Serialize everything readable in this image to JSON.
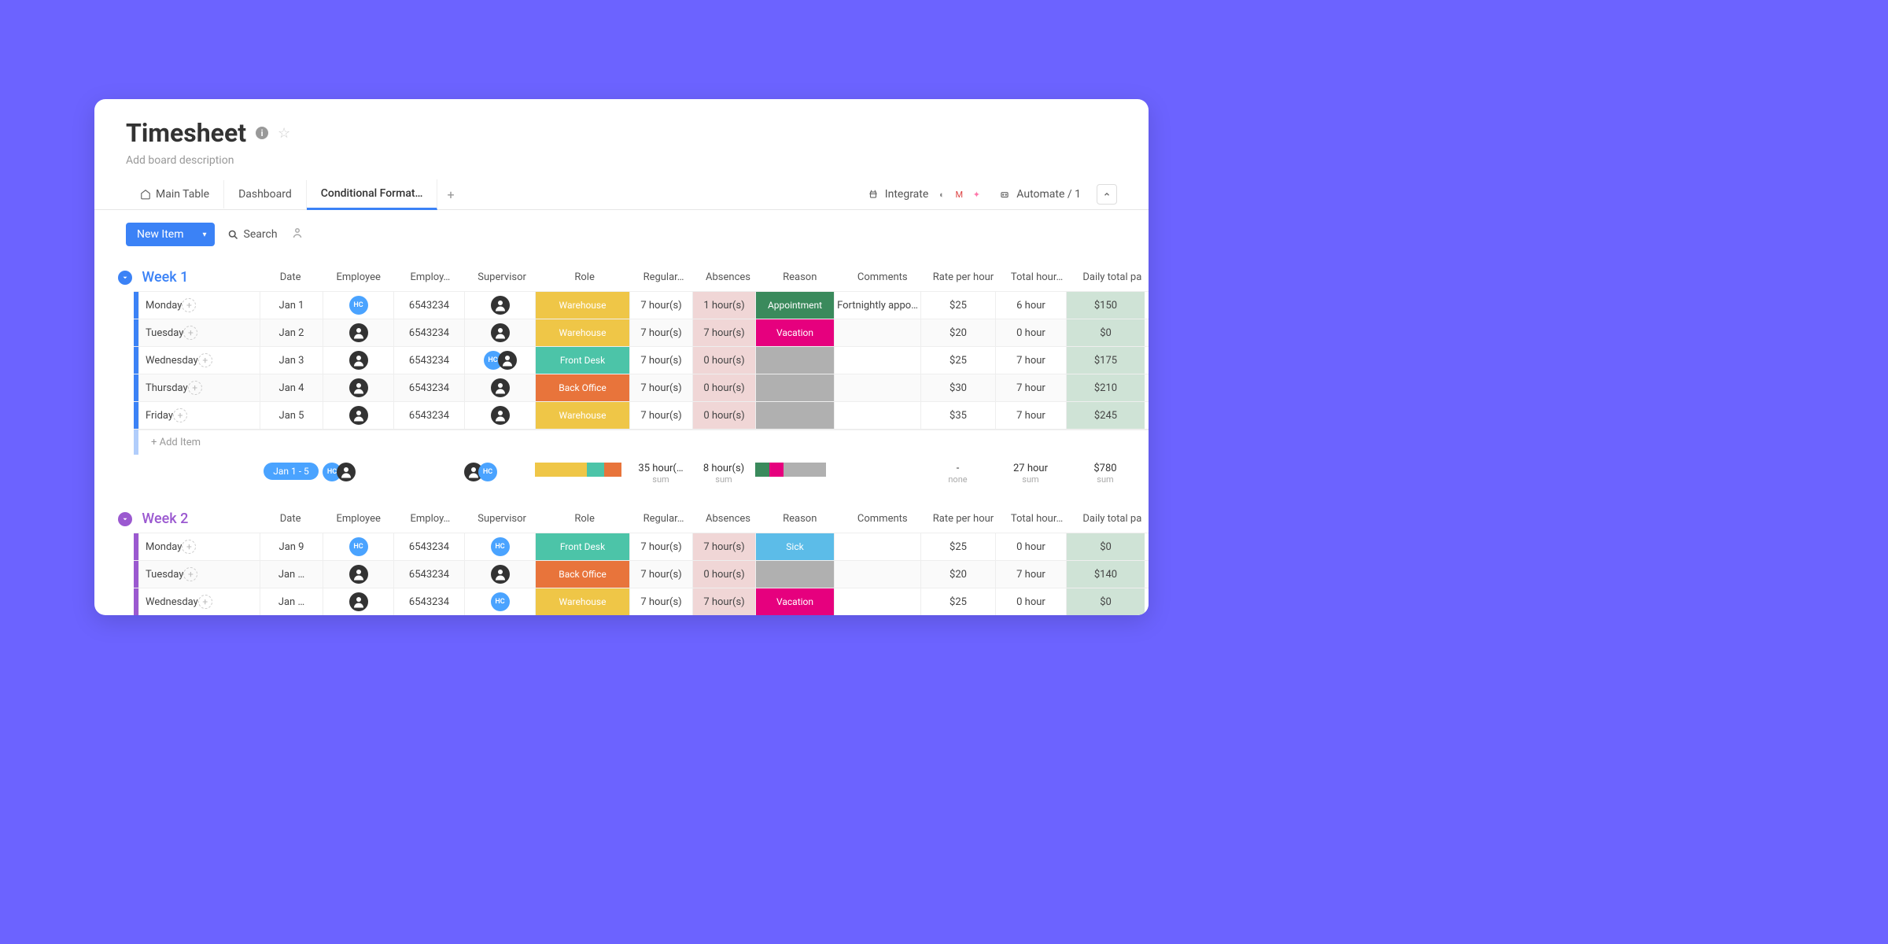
{
  "header": {
    "title": "Timesheet",
    "description": "Add board description"
  },
  "tabs": [
    {
      "label": "Main Table",
      "active": false,
      "has_icon": true
    },
    {
      "label": "Dashboard",
      "active": false,
      "has_icon": false
    },
    {
      "label": "Conditional Format…",
      "active": true,
      "has_icon": false
    }
  ],
  "top_actions": {
    "integrate": "Integrate",
    "automate": "Automate / 1"
  },
  "toolbar": {
    "new_item": "New Item",
    "search": "Search"
  },
  "columns": [
    "",
    "Date",
    "Employee",
    "Employ…",
    "Supervisor",
    "Role",
    "Regular…",
    "Absences",
    "Reason",
    "Comments",
    "Rate per hour",
    "Total hour…",
    "Daily total pa"
  ],
  "groups": [
    {
      "name": "Week 1",
      "color": "#3b82f6",
      "text_color": "#3b82f6",
      "rows": [
        {
          "item": "Monday",
          "date": "Jan 1",
          "emp": "hc",
          "empid": "6543234",
          "sup": "black",
          "role": "Warehouse",
          "role_color": "#efc647",
          "reg": "7 hour(s)",
          "abs": "1 hour(s)",
          "reason": "Appointment",
          "reason_color": "#3a8a5c",
          "comments": "Fortnightly appo…",
          "rate": "$25",
          "total": "6 hour",
          "daily": "$150"
        },
        {
          "item": "Tuesday",
          "date": "Jan 2",
          "emp": "black",
          "empid": "6543234",
          "sup": "black",
          "role": "Warehouse",
          "role_color": "#efc647",
          "reg": "7 hour(s)",
          "abs": "7 hour(s)",
          "reason": "Vacation",
          "reason_color": "#e6007e",
          "comments": "",
          "rate": "$20",
          "total": "0 hour",
          "daily": "$0"
        },
        {
          "item": "Wednesday",
          "date": "Jan 3",
          "emp": "black",
          "empid": "6543234",
          "sup": "hc+black",
          "role": "Front Desk",
          "role_color": "#4cc4a8",
          "reg": "7 hour(s)",
          "abs": "0 hour(s)",
          "reason": "",
          "reason_color": "#b0b0b0",
          "comments": "",
          "rate": "$25",
          "total": "7 hour",
          "daily": "$175"
        },
        {
          "item": "Thursday",
          "date": "Jan 4",
          "emp": "black",
          "empid": "6543234",
          "sup": "black",
          "role": "Back Office",
          "role_color": "#e8743b",
          "reg": "7 hour(s)",
          "abs": "0 hour(s)",
          "reason": "",
          "reason_color": "#b0b0b0",
          "comments": "",
          "rate": "$30",
          "total": "7 hour",
          "daily": "$210"
        },
        {
          "item": "Friday",
          "date": "Jan 5",
          "emp": "black",
          "empid": "6543234",
          "sup": "black",
          "role": "Warehouse",
          "role_color": "#efc647",
          "reg": "7 hour(s)",
          "abs": "0 hour(s)",
          "reason": "",
          "reason_color": "#b0b0b0",
          "comments": "",
          "rate": "$35",
          "total": "7 hour",
          "daily": "$245"
        }
      ],
      "add_item": "+ Add Item",
      "summary": {
        "date_range": "Jan 1 - 5",
        "reg": "35 hour(…",
        "reg_lbl": "sum",
        "abs": "8 hour(s)",
        "abs_lbl": "sum",
        "rate": "-",
        "rate_lbl": "none",
        "total": "27 hour",
        "total_lbl": "sum",
        "daily": "$780",
        "daily_lbl": "sum"
      }
    },
    {
      "name": "Week 2",
      "color": "#9b59d0",
      "text_color": "#9b59d0",
      "rows": [
        {
          "item": "Monday",
          "date": "Jan 9",
          "emp": "hc",
          "empid": "6543234",
          "sup": "hc",
          "role": "Front Desk",
          "role_color": "#4cc4a8",
          "reg": "7 hour(s)",
          "abs": "7 hour(s)",
          "reason": "Sick",
          "reason_color": "#5cbce8",
          "comments": "",
          "rate": "$25",
          "total": "0 hour",
          "daily": "$0"
        },
        {
          "item": "Tuesday",
          "date": "Jan …",
          "emp": "black",
          "empid": "6543234",
          "sup": "black",
          "role": "Back Office",
          "role_color": "#e8743b",
          "reg": "7 hour(s)",
          "abs": "0 hour(s)",
          "reason": "",
          "reason_color": "#b0b0b0",
          "comments": "",
          "rate": "$20",
          "total": "7 hour",
          "daily": "$140"
        },
        {
          "item": "Wednesday",
          "date": "Jan …",
          "emp": "black",
          "empid": "6543234",
          "sup": "hc",
          "role": "Warehouse",
          "role_color": "#efc647",
          "reg": "7 hour(s)",
          "abs": "7 hour(s)",
          "reason": "Vacation",
          "reason_color": "#e6007e",
          "comments": "",
          "rate": "$25",
          "total": "0 hour",
          "daily": "$0"
        }
      ]
    }
  ]
}
